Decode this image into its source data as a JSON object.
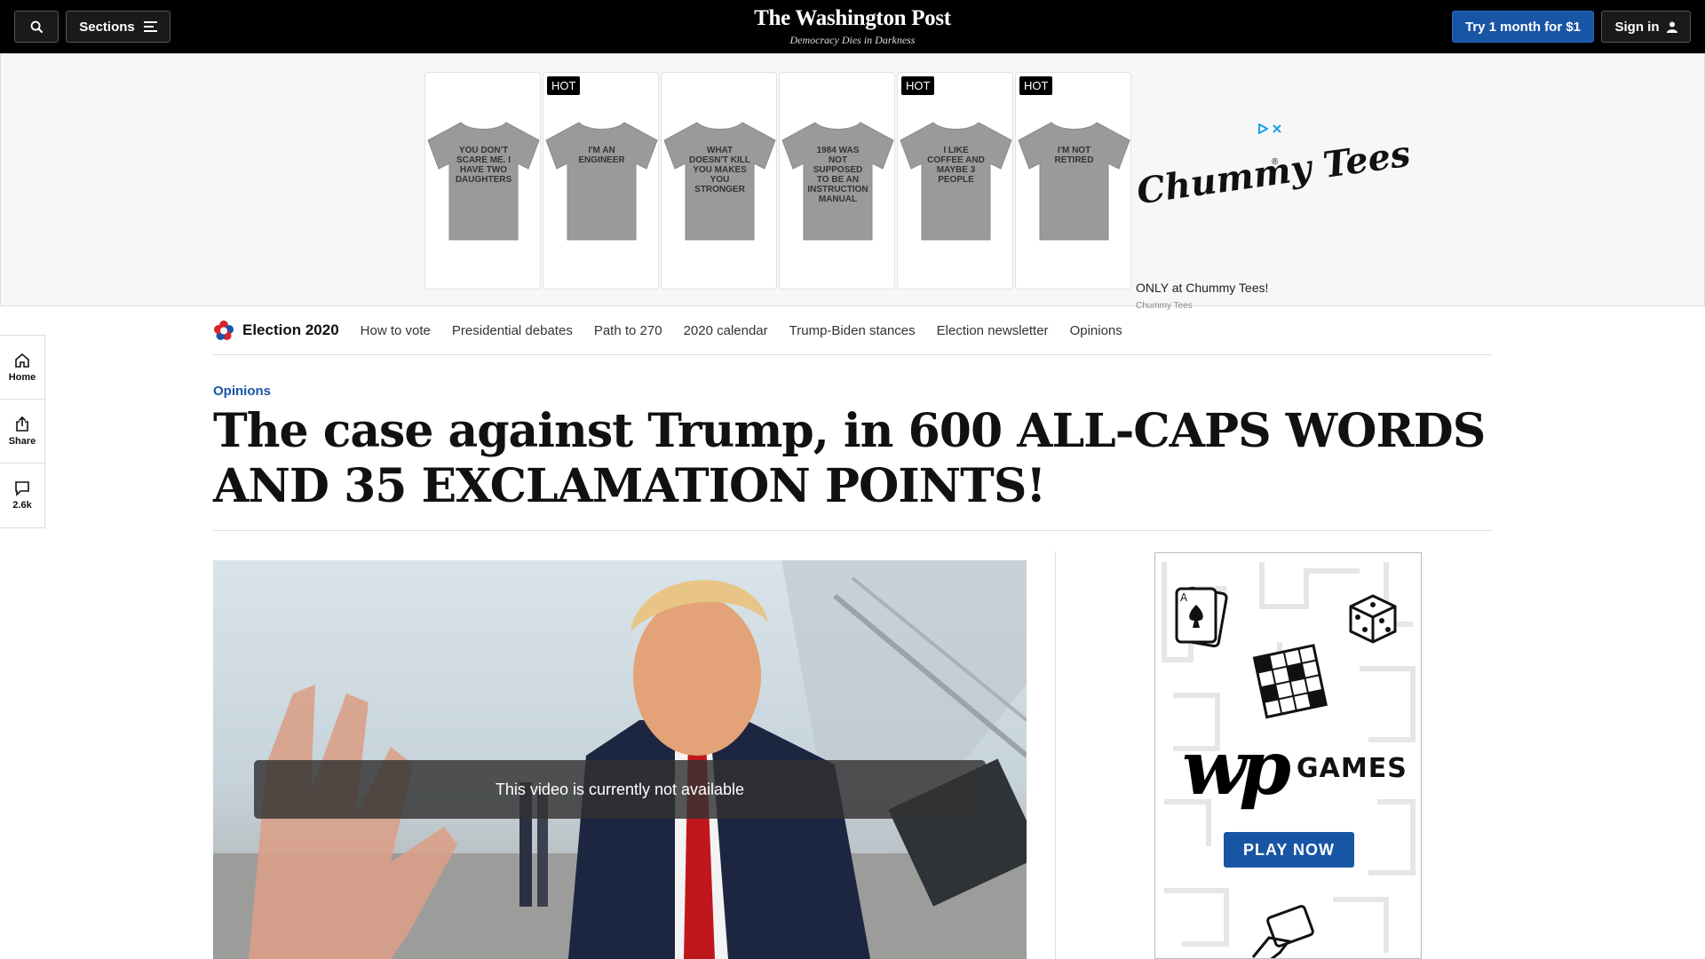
{
  "header": {
    "sections_label": "Sections",
    "logo_text": "The Washington Post",
    "tagline": "Democracy Dies in Darkness",
    "trial_label": "Try 1 month for $1",
    "signin_label": "Sign in"
  },
  "ad_banner": {
    "hot_label": "HOT",
    "products": [
      {
        "text": "YOU DON'T SCARE ME. I HAVE TWO DAUGHTERS",
        "hot": false
      },
      {
        "text": "I'M AN ENGINEER",
        "hot": true
      },
      {
        "text": "WHAT DOESN'T KILL YOU MAKES YOU STRONGER",
        "hot": false
      },
      {
        "text": "1984 WAS NOT SUPPOSED TO BE AN INSTRUCTION MANUAL",
        "hot": false
      },
      {
        "text": "I LIKE COFFEE AND MAYBE 3 PEOPLE",
        "hot": true
      },
      {
        "text": "I'M NOT RETIRED",
        "hot": true
      }
    ],
    "brand_logo": "Chummy Tees",
    "cta": "ONLY at Chummy Tees!",
    "brand_name": "Chummy Tees"
  },
  "left_rail": {
    "home_label": "Home",
    "share_label": "Share",
    "comments_count": "2.6k"
  },
  "election_nav": {
    "title": "Election 2020",
    "links": [
      "How to vote",
      "Presidential debates",
      "Path to 270",
      "2020 calendar",
      "Trump-Biden stances",
      "Election newsletter",
      "Opinions"
    ]
  },
  "article": {
    "kicker": "Opinions",
    "headline": "The case against Trump, in 600 ALL-CAPS WORDS AND 35 EXCLAMATION POINTS!"
  },
  "video": {
    "message": "This video is currently not available"
  },
  "games_ad": {
    "logo_mark": "wp",
    "title": "GAMES",
    "cta": "PLAY NOW"
  },
  "colors": {
    "brand_blue": "#1955a5",
    "topbar_bg": "#000000"
  }
}
